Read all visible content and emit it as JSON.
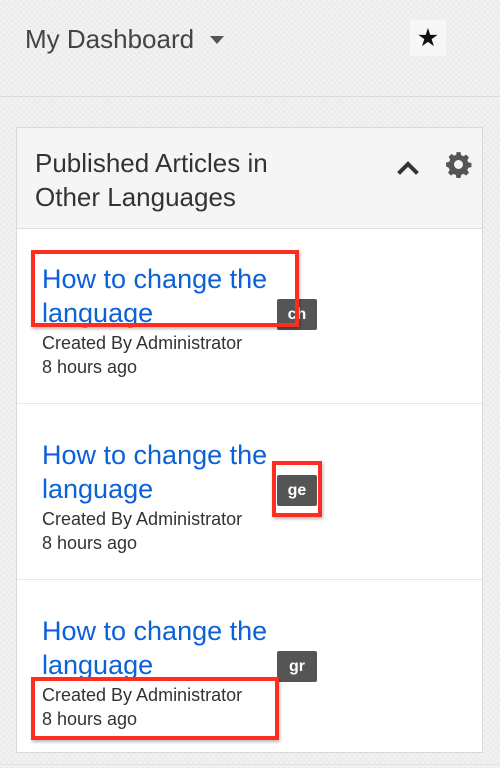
{
  "header": {
    "dashboard_title": "My Dashboard",
    "favorite_icon": "★"
  },
  "dashlet": {
    "title": "Published Articles in Other Languages",
    "collapse_icon": "chevron-up-icon",
    "settings_icon": "gear-icon",
    "articles": [
      {
        "title_line_1": "How to change the",
        "title_line_2": "language",
        "created_by": "Created By Administrator",
        "time": "8 hours ago",
        "language": "ch"
      },
      {
        "title_line_1": "How to change the",
        "title_line_2": "language",
        "created_by": "Created By Administrator",
        "time": "8 hours ago",
        "language": "ge"
      },
      {
        "title_line_1": "How to change the",
        "title_line_2": "language",
        "created_by": "Created By Administrator",
        "time": "8 hours ago",
        "language": "gr"
      }
    ]
  },
  "colors": {
    "link": "#0b61d8",
    "highlight": "#ff2d20",
    "badge": "#555555"
  }
}
